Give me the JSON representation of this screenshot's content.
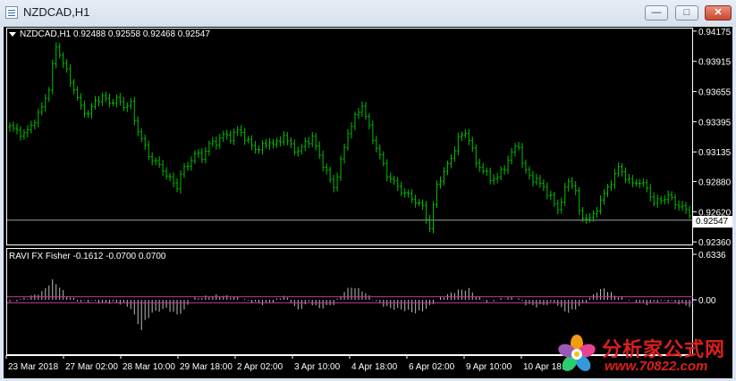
{
  "window": {
    "title": "NZDCAD,H1",
    "minimize_label": "—",
    "maximize_label": "□",
    "close_label": "✕"
  },
  "main_chart": {
    "header": "NZDCAD,H1  0.92488 0.92558 0.92468 0.92547",
    "current_price": "0.92547"
  },
  "indicator": {
    "header": "RAVI FX Fisher -0.1612 -0.0700 0.0700"
  },
  "chart_data": [
    {
      "type": "bar",
      "title": "NZDCAD,H1",
      "ohlc_last": {
        "open": 0.92488,
        "high": 0.92558,
        "low": 0.92468,
        "close": 0.92547
      },
      "y_ticks": [
        "0.94175",
        "0.93915",
        "0.93655",
        "0.93395",
        "0.93135",
        "0.92880",
        "0.92620",
        "0.92360"
      ],
      "ylim": [
        0.9233,
        0.94205
      ],
      "grid": false,
      "x_ticks": [
        "23 Mar 2018",
        "27 Mar 02:00",
        "28 Mar 10:00",
        "29 Mar 18:00",
        "2 Apr 02:00",
        "3 Apr 10:00",
        "4 Apr 18:00",
        "6 Apr 02:00",
        "9 Apr 10:00",
        "10 Apr 18:00"
      ],
      "colors": {
        "bars": "#00c000",
        "background": "#000000",
        "price_line": "#a0a0a0"
      },
      "close_path": [
        [
          0,
          0.9335
        ],
        [
          4,
          0.9328
        ],
        [
          8,
          0.9345
        ],
        [
          11,
          0.9368
        ],
        [
          13,
          0.9405
        ],
        [
          15,
          0.939
        ],
        [
          17,
          0.9375
        ],
        [
          20,
          0.9352
        ],
        [
          22,
          0.9346
        ],
        [
          24,
          0.9357
        ],
        [
          26,
          0.9361
        ],
        [
          28,
          0.9356
        ],
        [
          30,
          0.9359
        ],
        [
          32,
          0.9353
        ],
        [
          34,
          0.9355
        ],
        [
          35,
          0.934
        ],
        [
          37,
          0.9325
        ],
        [
          39,
          0.931
        ],
        [
          41,
          0.9305
        ],
        [
          43,
          0.9298
        ],
        [
          45,
          0.929
        ],
        [
          47,
          0.9283
        ],
        [
          48,
          0.9295
        ],
        [
          50,
          0.9302
        ],
        [
          52,
          0.9312
        ],
        [
          54,
          0.9309
        ],
        [
          56,
          0.932
        ],
        [
          58,
          0.9322
        ],
        [
          60,
          0.9328
        ],
        [
          62,
          0.9326
        ],
        [
          64,
          0.9332
        ],
        [
          65,
          0.933
        ],
        [
          67,
          0.9322
        ],
        [
          69,
          0.9316
        ],
        [
          71,
          0.9318
        ],
        [
          73,
          0.9322
        ],
        [
          75,
          0.932
        ],
        [
          77,
          0.9328
        ],
        [
          79,
          0.9318
        ],
        [
          81,
          0.9314
        ],
        [
          83,
          0.9321
        ],
        [
          85,
          0.9326
        ],
        [
          87,
          0.931
        ],
        [
          89,
          0.9296
        ],
        [
          91,
          0.9283
        ],
        [
          93,
          0.9305
        ],
        [
          95,
          0.933
        ],
        [
          97,
          0.9343
        ],
        [
          99,
          0.9354
        ],
        [
          100,
          0.9344
        ],
        [
          102,
          0.9325
        ],
        [
          104,
          0.931
        ],
        [
          106,
          0.9294
        ],
        [
          108,
          0.9287
        ],
        [
          110,
          0.928
        ],
        [
          112,
          0.9276
        ],
        [
          114,
          0.9271
        ],
        [
          116,
          0.9266
        ],
        [
          118,
          0.9248
        ],
        [
          120,
          0.9285
        ],
        [
          122,
          0.9296
        ],
        [
          124,
          0.9308
        ],
        [
          126,
          0.9325
        ],
        [
          128,
          0.933
        ],
        [
          129,
          0.9325
        ],
        [
          131,
          0.9304
        ],
        [
          133,
          0.9298
        ],
        [
          135,
          0.929
        ],
        [
          137,
          0.9292
        ],
        [
          139,
          0.93
        ],
        [
          141,
          0.9313
        ],
        [
          143,
          0.932
        ],
        [
          144,
          0.9303
        ],
        [
          146,
          0.9292
        ],
        [
          148,
          0.9289
        ],
        [
          150,
          0.9283
        ],
        [
          152,
          0.9274
        ],
        [
          154,
          0.9264
        ],
        [
          155,
          0.9272
        ],
        [
          157,
          0.9289
        ],
        [
          159,
          0.9281
        ],
        [
          160,
          0.926
        ],
        [
          162,
          0.9256
        ],
        [
          164,
          0.9258
        ],
        [
          166,
          0.9272
        ],
        [
          168,
          0.9282
        ],
        [
          170,
          0.9294
        ],
        [
          171,
          0.93
        ],
        [
          173,
          0.9292
        ],
        [
          175,
          0.9286
        ],
        [
          177,
          0.9288
        ],
        [
          179,
          0.9282
        ],
        [
          181,
          0.927
        ],
        [
          183,
          0.9272
        ],
        [
          185,
          0.9276
        ],
        [
          187,
          0.9269
        ],
        [
          189,
          0.9266
        ],
        [
          191,
          0.926
        ]
      ]
    },
    {
      "type": "bar",
      "title": "RAVI FX Fisher",
      "values_last": [
        -0.1612,
        -0.07,
        0.07
      ],
      "y_ticks": [
        "0.6336",
        "0.00"
      ],
      "levels": [
        0.07,
        -0.07
      ],
      "colors": {
        "histogram": "#bcbcbc",
        "levels": "#c0399a"
      },
      "keypoints": [
        [
          0,
          -0.05
        ],
        [
          5,
          0.05
        ],
        [
          9,
          0.18
        ],
        [
          12,
          0.45
        ],
        [
          14,
          0.3
        ],
        [
          16,
          0.1
        ],
        [
          18,
          0.02
        ],
        [
          20,
          -0.05
        ],
        [
          23,
          -0.02
        ],
        [
          26,
          -0.08
        ],
        [
          29,
          -0.06
        ],
        [
          32,
          -0.1
        ],
        [
          34,
          -0.2
        ],
        [
          36,
          -0.55
        ],
        [
          37,
          -0.7
        ],
        [
          38,
          -0.5
        ],
        [
          40,
          -0.3
        ],
        [
          44,
          -0.2
        ],
        [
          47,
          -0.35
        ],
        [
          49,
          -0.25
        ],
        [
          51,
          0.02
        ],
        [
          54,
          0.06
        ],
        [
          58,
          0.1
        ],
        [
          62,
          0.08
        ],
        [
          65,
          0.03
        ],
        [
          68,
          -0.05
        ],
        [
          71,
          -0.1
        ],
        [
          74,
          -0.05
        ],
        [
          77,
          0.1
        ],
        [
          79,
          -0.05
        ],
        [
          81,
          -0.25
        ],
        [
          84,
          -0.05
        ],
        [
          87,
          -0.2
        ],
        [
          91,
          -0.1
        ],
        [
          94,
          0.2
        ],
        [
          96,
          0.3
        ],
        [
          99,
          0.22
        ],
        [
          101,
          0.08
        ],
        [
          104,
          -0.1
        ],
        [
          107,
          -0.2
        ],
        [
          110,
          -0.22
        ],
        [
          114,
          -0.3
        ],
        [
          116,
          -0.25
        ],
        [
          118,
          -0.15
        ],
        [
          120,
          0.0
        ],
        [
          123,
          0.12
        ],
        [
          126,
          0.22
        ],
        [
          129,
          0.25
        ],
        [
          131,
          0.1
        ],
        [
          134,
          -0.05
        ],
        [
          137,
          0.0
        ],
        [
          140,
          0.05
        ],
        [
          143,
          0.02
        ],
        [
          145,
          -0.1
        ],
        [
          148,
          -0.15
        ],
        [
          151,
          -0.1
        ],
        [
          153,
          -0.05
        ],
        [
          155,
          -0.2
        ],
        [
          157,
          -0.3
        ],
        [
          159,
          -0.2
        ],
        [
          162,
          -0.05
        ],
        [
          165,
          0.2
        ],
        [
          167,
          0.26
        ],
        [
          170,
          0.1
        ],
        [
          173,
          0.02
        ],
        [
          176,
          -0.05
        ],
        [
          179,
          -0.1
        ],
        [
          182,
          -0.05
        ],
        [
          185,
          -0.02
        ],
        [
          188,
          -0.08
        ],
        [
          191,
          -0.15
        ]
      ]
    }
  ],
  "watermark": {
    "title": "分析家公式网",
    "url": "www.70822.com"
  }
}
